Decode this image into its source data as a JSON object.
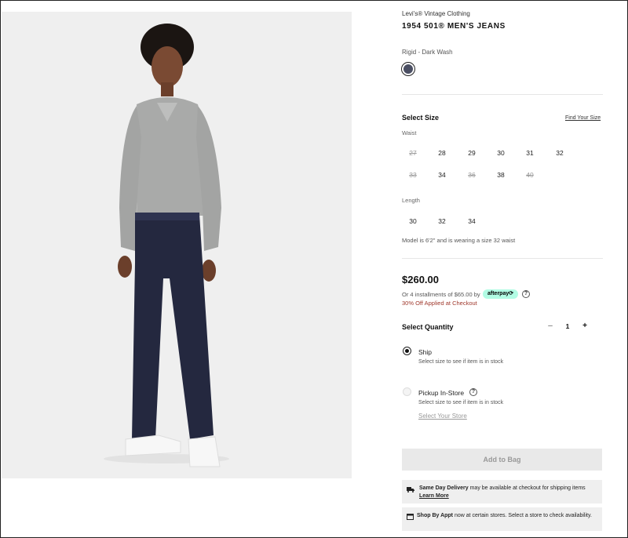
{
  "product": {
    "brand": "Levi's® Vintage Clothing",
    "title": "1954 501® MEN'S JEANS",
    "color_name": "Rigid - Dark Wash",
    "swatch_color": "#4b4f63"
  },
  "size": {
    "heading": "Select Size",
    "find_link": "Find Your Size",
    "waist_label": "Waist",
    "waist_options": [
      {
        "label": "27",
        "available": false
      },
      {
        "label": "28",
        "available": true
      },
      {
        "label": "29",
        "available": true
      },
      {
        "label": "30",
        "available": true
      },
      {
        "label": "31",
        "available": true
      },
      {
        "label": "32",
        "available": true
      },
      {
        "label": "33",
        "available": false
      },
      {
        "label": "34",
        "available": true
      },
      {
        "label": "36",
        "available": false
      },
      {
        "label": "38",
        "available": true
      },
      {
        "label": "40",
        "available": false
      }
    ],
    "length_label": "Length",
    "length_options": [
      {
        "label": "30",
        "available": true
      },
      {
        "label": "32",
        "available": true
      },
      {
        "label": "34",
        "available": true
      }
    ],
    "model_note": "Model is 6'2\" and is wearing a size 32 waist"
  },
  "pricing": {
    "price": "$260.00",
    "installments": "Or 4 installments of $65.00 by",
    "afterpay_label": "afterpay⟳",
    "help_glyph": "?",
    "discount": "30% Off Applied at Checkout"
  },
  "quantity": {
    "heading": "Select Quantity",
    "minus": "–",
    "value": "1",
    "plus": "+"
  },
  "fulfillment": {
    "ship_title": "Ship",
    "ship_sub": "Select size to see if item is in stock",
    "pickup_title": "Pickup In-Store",
    "pickup_help": "?",
    "pickup_sub": "Select size to see if item is in stock",
    "store_link": "Select Your Store"
  },
  "cta": {
    "add_to_bag": "Add to Bag"
  },
  "info": {
    "same_day_bold": "Same Day Delivery",
    "same_day_text": " may be available at checkout for shipping items",
    "learn_more": "Learn More",
    "appt_bold": "Shop By Appt",
    "appt_text": " now at certain stores. Select a store to check availability."
  }
}
